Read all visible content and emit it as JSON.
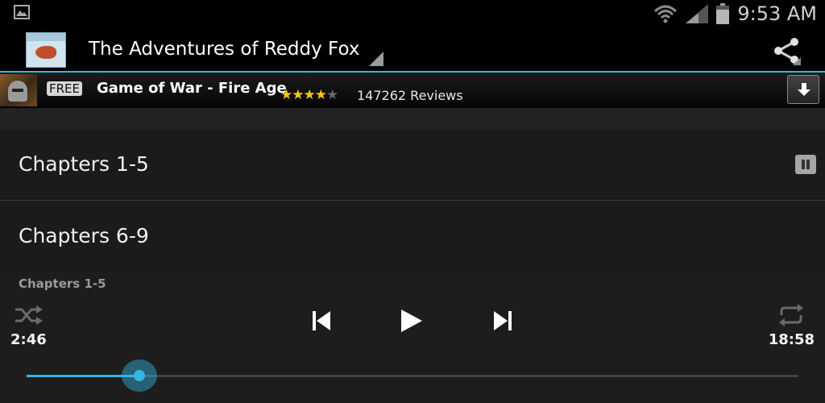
{
  "status_bar": {
    "time": "9:53 AM",
    "icons": [
      "gallery-notification-icon",
      "wifi-icon",
      "signal-icon",
      "battery-icon"
    ]
  },
  "action_bar": {
    "title": "The Adventures of Reddy Fox",
    "icons": [
      "book-cover-icon",
      "spinner-triangle-icon",
      "share-icon"
    ]
  },
  "ad_banner": {
    "badge": "FREE",
    "app_name": "Game of War - Fire Age",
    "rating": 4,
    "rating_max": 5,
    "reviews": "147262 Reviews",
    "icons": [
      "game-app-icon",
      "star-icon",
      "download-icon"
    ]
  },
  "chapters": [
    {
      "label": "Chapters 1-5",
      "playing": true
    },
    {
      "label": "Chapters 6-9",
      "playing": false
    }
  ],
  "player": {
    "now_playing": "Chapters 1-5",
    "elapsed": "2:46",
    "duration": "18:58",
    "progress": 0.146,
    "icons": [
      "shuffle-icon",
      "previous-icon",
      "play-icon",
      "next-icon",
      "repeat-icon"
    ]
  },
  "colors": {
    "accent": "#33b5e5",
    "background": "#1b1b1b",
    "star": "#f5c518"
  }
}
